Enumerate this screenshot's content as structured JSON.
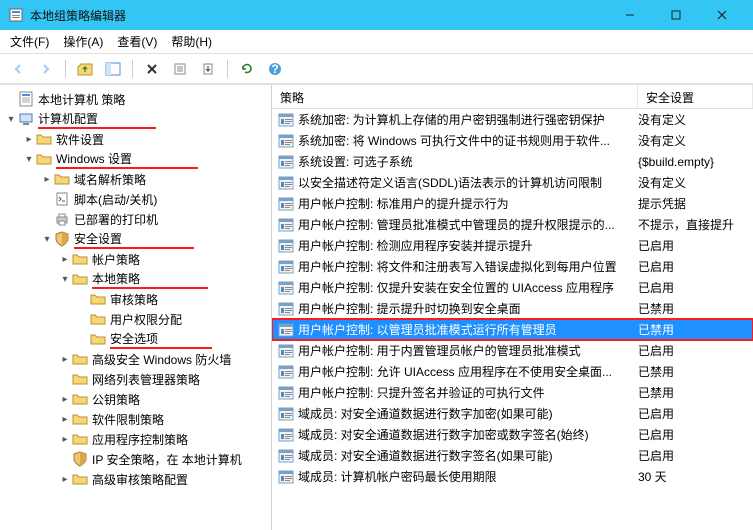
{
  "window": {
    "title": "本地组策略编辑器"
  },
  "menu": {
    "file": "文件(F)",
    "action": "操作(A)",
    "view": "查看(V)",
    "help": "帮助(H)"
  },
  "tree": {
    "root": "本地计算机 策略",
    "computer_config": "计算机配置",
    "software_settings": "软件设置",
    "windows_settings": "Windows 设置",
    "dns_policy": "域名解析策略",
    "scripts": "脚本(启动/关机)",
    "deployed_printers": "已部署的打印机",
    "security_settings": "安全设置",
    "account_policies": "帐户策略",
    "local_policies": "本地策略",
    "audit_policy": "审核策略",
    "user_rights": "用户权限分配",
    "security_options": "安全选项",
    "adv_firewall": "高级安全 Windows 防火墙",
    "network_list": "网络列表管理器策略",
    "public_key": "公钥策略",
    "software_restrict": "软件限制策略",
    "app_control": "应用程序控制策略",
    "ip_security": "IP 安全策略，在 本地计算机",
    "adv_audit": "高级审核策略配置"
  },
  "columns": {
    "policy": "策略",
    "setting": "安全设置"
  },
  "rows": [
    {
      "policy": "系统加密: 为计算机上存储的用户密钥强制进行强密钥保护",
      "setting": "没有定义"
    },
    {
      "policy": "系统加密: 将 Windows 可执行文件中的证书规则用于软件...",
      "setting": "没有定义"
    },
    {
      "policy": "系统设置: 可选子系统",
      "setting": "{$build.empty}"
    },
    {
      "policy": "以安全描述符定义语言(SDDL)语法表示的计算机访问限制",
      "setting": "没有定义"
    },
    {
      "policy": "用户帐户控制: 标准用户的提升提示行为",
      "setting": "提示凭据"
    },
    {
      "policy": "用户帐户控制: 管理员批准模式中管理员的提升权限提示的...",
      "setting": "不提示，直接提升"
    },
    {
      "policy": "用户帐户控制: 检测应用程序安装并提示提升",
      "setting": "已启用"
    },
    {
      "policy": "用户帐户控制: 将文件和注册表写入错误虚拟化到每用户位置",
      "setting": "已启用"
    },
    {
      "policy": "用户帐户控制: 仅提升安装在安全位置的 UIAccess 应用程序",
      "setting": "已启用"
    },
    {
      "policy": "用户帐户控制: 提示提升时切换到安全桌面",
      "setting": "已禁用"
    },
    {
      "policy": "用户帐户控制: 以管理员批准模式运行所有管理员",
      "setting": "已禁用",
      "selected": true
    },
    {
      "policy": "用户帐户控制: 用于内置管理员帐户的管理员批准模式",
      "setting": "已启用"
    },
    {
      "policy": "用户帐户控制: 允许 UIAccess 应用程序在不使用安全桌面...",
      "setting": "已禁用"
    },
    {
      "policy": "用户帐户控制: 只提升签名并验证的可执行文件",
      "setting": "已禁用"
    },
    {
      "policy": "域成员: 对安全通道数据进行数字加密(如果可能)",
      "setting": "已启用"
    },
    {
      "policy": "域成员: 对安全通道数据进行数字加密或数字签名(始终)",
      "setting": "已启用"
    },
    {
      "policy": "域成员: 对安全通道数据进行数字签名(如果可能)",
      "setting": "已启用"
    },
    {
      "policy": "域成员: 计算机帐户密码最长使用期限",
      "setting": "30 天"
    }
  ]
}
